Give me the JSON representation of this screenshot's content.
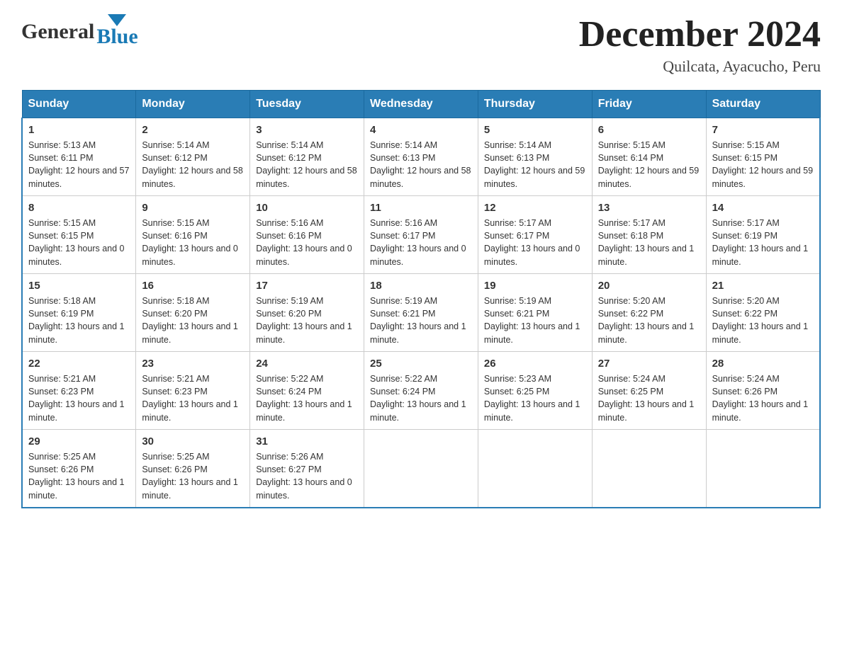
{
  "header": {
    "logo_general": "General",
    "logo_blue": "Blue",
    "month_title": "December 2024",
    "location": "Quilcata, Ayacucho, Peru"
  },
  "days_of_week": [
    "Sunday",
    "Monday",
    "Tuesday",
    "Wednesday",
    "Thursday",
    "Friday",
    "Saturday"
  ],
  "weeks": [
    [
      {
        "day": "1",
        "sunrise": "Sunrise: 5:13 AM",
        "sunset": "Sunset: 6:11 PM",
        "daylight": "Daylight: 12 hours and 57 minutes."
      },
      {
        "day": "2",
        "sunrise": "Sunrise: 5:14 AM",
        "sunset": "Sunset: 6:12 PM",
        "daylight": "Daylight: 12 hours and 58 minutes."
      },
      {
        "day": "3",
        "sunrise": "Sunrise: 5:14 AM",
        "sunset": "Sunset: 6:12 PM",
        "daylight": "Daylight: 12 hours and 58 minutes."
      },
      {
        "day": "4",
        "sunrise": "Sunrise: 5:14 AM",
        "sunset": "Sunset: 6:13 PM",
        "daylight": "Daylight: 12 hours and 58 minutes."
      },
      {
        "day": "5",
        "sunrise": "Sunrise: 5:14 AM",
        "sunset": "Sunset: 6:13 PM",
        "daylight": "Daylight: 12 hours and 59 minutes."
      },
      {
        "day": "6",
        "sunrise": "Sunrise: 5:15 AM",
        "sunset": "Sunset: 6:14 PM",
        "daylight": "Daylight: 12 hours and 59 minutes."
      },
      {
        "day": "7",
        "sunrise": "Sunrise: 5:15 AM",
        "sunset": "Sunset: 6:15 PM",
        "daylight": "Daylight: 12 hours and 59 minutes."
      }
    ],
    [
      {
        "day": "8",
        "sunrise": "Sunrise: 5:15 AM",
        "sunset": "Sunset: 6:15 PM",
        "daylight": "Daylight: 13 hours and 0 minutes."
      },
      {
        "day": "9",
        "sunrise": "Sunrise: 5:15 AM",
        "sunset": "Sunset: 6:16 PM",
        "daylight": "Daylight: 13 hours and 0 minutes."
      },
      {
        "day": "10",
        "sunrise": "Sunrise: 5:16 AM",
        "sunset": "Sunset: 6:16 PM",
        "daylight": "Daylight: 13 hours and 0 minutes."
      },
      {
        "day": "11",
        "sunrise": "Sunrise: 5:16 AM",
        "sunset": "Sunset: 6:17 PM",
        "daylight": "Daylight: 13 hours and 0 minutes."
      },
      {
        "day": "12",
        "sunrise": "Sunrise: 5:17 AM",
        "sunset": "Sunset: 6:17 PM",
        "daylight": "Daylight: 13 hours and 0 minutes."
      },
      {
        "day": "13",
        "sunrise": "Sunrise: 5:17 AM",
        "sunset": "Sunset: 6:18 PM",
        "daylight": "Daylight: 13 hours and 1 minute."
      },
      {
        "day": "14",
        "sunrise": "Sunrise: 5:17 AM",
        "sunset": "Sunset: 6:19 PM",
        "daylight": "Daylight: 13 hours and 1 minute."
      }
    ],
    [
      {
        "day": "15",
        "sunrise": "Sunrise: 5:18 AM",
        "sunset": "Sunset: 6:19 PM",
        "daylight": "Daylight: 13 hours and 1 minute."
      },
      {
        "day": "16",
        "sunrise": "Sunrise: 5:18 AM",
        "sunset": "Sunset: 6:20 PM",
        "daylight": "Daylight: 13 hours and 1 minute."
      },
      {
        "day": "17",
        "sunrise": "Sunrise: 5:19 AM",
        "sunset": "Sunset: 6:20 PM",
        "daylight": "Daylight: 13 hours and 1 minute."
      },
      {
        "day": "18",
        "sunrise": "Sunrise: 5:19 AM",
        "sunset": "Sunset: 6:21 PM",
        "daylight": "Daylight: 13 hours and 1 minute."
      },
      {
        "day": "19",
        "sunrise": "Sunrise: 5:19 AM",
        "sunset": "Sunset: 6:21 PM",
        "daylight": "Daylight: 13 hours and 1 minute."
      },
      {
        "day": "20",
        "sunrise": "Sunrise: 5:20 AM",
        "sunset": "Sunset: 6:22 PM",
        "daylight": "Daylight: 13 hours and 1 minute."
      },
      {
        "day": "21",
        "sunrise": "Sunrise: 5:20 AM",
        "sunset": "Sunset: 6:22 PM",
        "daylight": "Daylight: 13 hours and 1 minute."
      }
    ],
    [
      {
        "day": "22",
        "sunrise": "Sunrise: 5:21 AM",
        "sunset": "Sunset: 6:23 PM",
        "daylight": "Daylight: 13 hours and 1 minute."
      },
      {
        "day": "23",
        "sunrise": "Sunrise: 5:21 AM",
        "sunset": "Sunset: 6:23 PM",
        "daylight": "Daylight: 13 hours and 1 minute."
      },
      {
        "day": "24",
        "sunrise": "Sunrise: 5:22 AM",
        "sunset": "Sunset: 6:24 PM",
        "daylight": "Daylight: 13 hours and 1 minute."
      },
      {
        "day": "25",
        "sunrise": "Sunrise: 5:22 AM",
        "sunset": "Sunset: 6:24 PM",
        "daylight": "Daylight: 13 hours and 1 minute."
      },
      {
        "day": "26",
        "sunrise": "Sunrise: 5:23 AM",
        "sunset": "Sunset: 6:25 PM",
        "daylight": "Daylight: 13 hours and 1 minute."
      },
      {
        "day": "27",
        "sunrise": "Sunrise: 5:24 AM",
        "sunset": "Sunset: 6:25 PM",
        "daylight": "Daylight: 13 hours and 1 minute."
      },
      {
        "day": "28",
        "sunrise": "Sunrise: 5:24 AM",
        "sunset": "Sunset: 6:26 PM",
        "daylight": "Daylight: 13 hours and 1 minute."
      }
    ],
    [
      {
        "day": "29",
        "sunrise": "Sunrise: 5:25 AM",
        "sunset": "Sunset: 6:26 PM",
        "daylight": "Daylight: 13 hours and 1 minute."
      },
      {
        "day": "30",
        "sunrise": "Sunrise: 5:25 AM",
        "sunset": "Sunset: 6:26 PM",
        "daylight": "Daylight: 13 hours and 1 minute."
      },
      {
        "day": "31",
        "sunrise": "Sunrise: 5:26 AM",
        "sunset": "Sunset: 6:27 PM",
        "daylight": "Daylight: 13 hours and 0 minutes."
      },
      {
        "day": "",
        "sunrise": "",
        "sunset": "",
        "daylight": ""
      },
      {
        "day": "",
        "sunrise": "",
        "sunset": "",
        "daylight": ""
      },
      {
        "day": "",
        "sunrise": "",
        "sunset": "",
        "daylight": ""
      },
      {
        "day": "",
        "sunrise": "",
        "sunset": "",
        "daylight": ""
      }
    ]
  ]
}
